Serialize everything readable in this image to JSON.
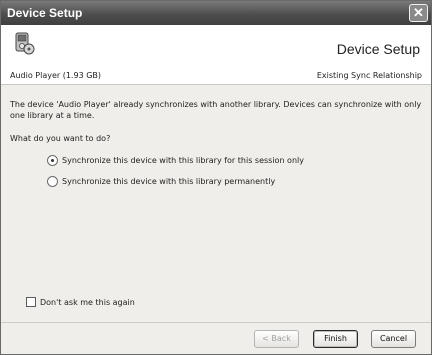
{
  "window": {
    "title": "Device Setup",
    "close_glyph": "✕"
  },
  "header": {
    "title": "Device Setup",
    "device_name": "Audio Player (1.93 GB)",
    "subtitle": "Existing Sync Relationship",
    "icon": "portable-device-icon"
  },
  "content": {
    "description": "The device 'Audio Player' already synchronizes with another library. Devices can synchronize with only one library at a time.",
    "question": "What do you want to do?",
    "options": [
      {
        "label": "Synchronize this device with this library for this session only",
        "selected": true
      },
      {
        "label": "Synchronize this device with this library permanently",
        "selected": false
      }
    ],
    "dont_ask": {
      "label": "Don't ask me this again",
      "checked": false
    }
  },
  "footer": {
    "back_label": "< Back",
    "finish_label": "Finish",
    "cancel_label": "Cancel"
  }
}
